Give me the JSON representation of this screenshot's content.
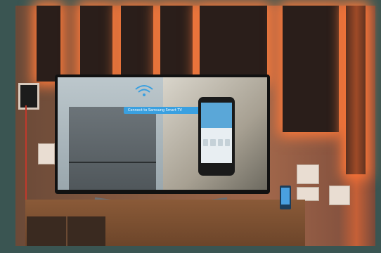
{
  "photo": {
    "subject": "",
    "notification_text": "Connect to Samsung Smart TV"
  },
  "colors": {
    "frame": "#3a5552",
    "accent_glow": "#ff7a3a",
    "notification": "#3aa0e0"
  }
}
